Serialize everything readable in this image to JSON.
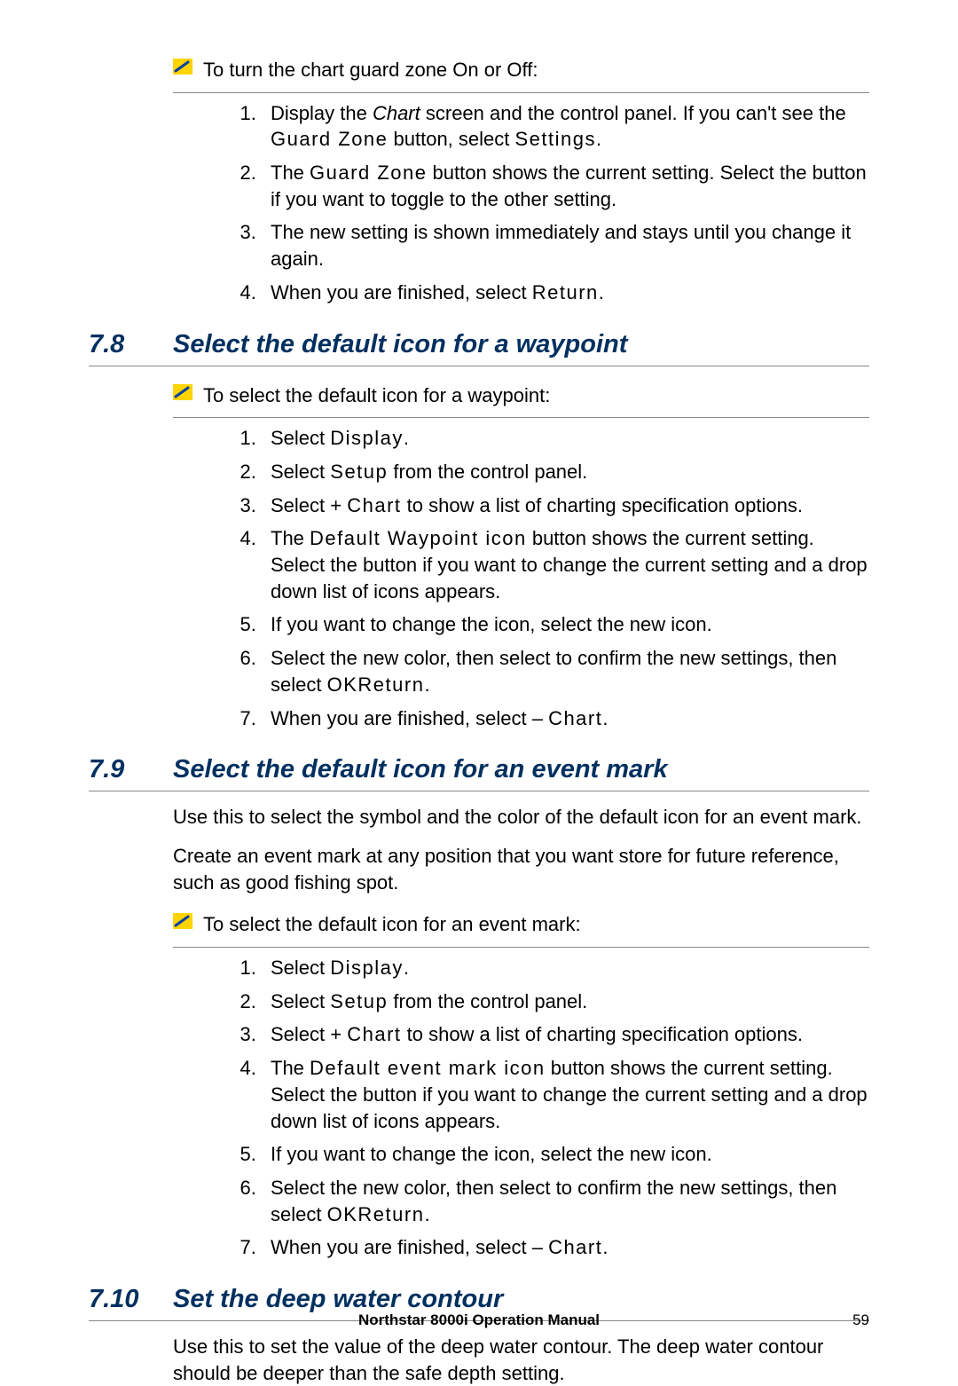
{
  "task1": {
    "intro": "To turn the chart guard zone On or Off:",
    "steps": [
      {
        "pre": "Display the ",
        "em": "Chart",
        "mid": " screen and the control panel. If you can't see the ",
        "ui1": "Guard Zone",
        "mid2": " button, select ",
        "ui2": "Settings",
        "post": "."
      },
      {
        "pre": "The ",
        "ui1": "Guard Zone",
        "post": " button shows the current setting. Select the button if you want to toggle to the other setting."
      },
      {
        "plain": "The new setting is shown immediately and stays until you change it again."
      },
      {
        "pre": "When you are finished, select ",
        "ui1": "Return",
        "post": "."
      }
    ]
  },
  "section78": {
    "num": "7.8",
    "title": "Select the default icon for a waypoint"
  },
  "task2": {
    "intro": "To select the default icon for a waypoint:",
    "steps": [
      {
        "pre": "Select ",
        "ui1": "Display",
        "post": "."
      },
      {
        "pre": "Select  ",
        "ui1": "Setup",
        "post": " from the control panel."
      },
      {
        "pre": "Select +  ",
        "ui1": "Chart",
        "post": " to show a list of charting specification options."
      },
      {
        "pre": "The ",
        "ui1": "Default Waypoint icon",
        "post": " button shows the current setting. Select the button if you want to change the current setting and a drop down list of icons appears."
      },
      {
        "plain": "If you want to change the icon, select the new icon."
      },
      {
        "pre": "Select the new color, then select ",
        "ui1": "OK",
        "mid": "  to confirm the new settings, then select ",
        "ui2": "Return",
        "post": "."
      },
      {
        "pre": "When you are finished, select –  ",
        "ui1": "Chart",
        "post": "."
      }
    ]
  },
  "section79": {
    "num": "7.9",
    "title": "Select the default icon for an event mark"
  },
  "para79a": "Use this to select the symbol and the color of the default icon for an event mark.",
  "para79b": "Create an event mark at any position that you want store for future reference, such as good fishing spot.",
  "task3": {
    "intro": "To select the default icon for an event mark:",
    "steps": [
      {
        "pre": "Select ",
        "ui1": "Display",
        "post": "."
      },
      {
        "pre": "Select  ",
        "ui1": "Setup",
        "post": " from the control panel."
      },
      {
        "pre": "Select +  ",
        "ui1": "Chart",
        "post": " to show a list of charting specification options."
      },
      {
        "pre": "The ",
        "ui1": "Default event mark icon",
        "post": " button shows the current setting. Select the button if you want to change the current setting and a drop down list of icons appears."
      },
      {
        "plain": "If you want to change the icon, select the new icon."
      },
      {
        "pre": "Select the new color, then select ",
        "ui1": "OK",
        "mid": "  to confirm the new settings, then select ",
        "ui2": "Return",
        "post": "."
      },
      {
        "pre": "When you are finished, select –  ",
        "ui1": "Chart",
        "post": "."
      }
    ]
  },
  "section710": {
    "num": "7.10",
    "title": "Set the deep water contour"
  },
  "para710": "Use this to set the value of the deep water contour. The deep water contour should be deeper than the safe depth setting.",
  "footer": {
    "title": "Northstar 8000i Operation Manual",
    "page": "59"
  }
}
